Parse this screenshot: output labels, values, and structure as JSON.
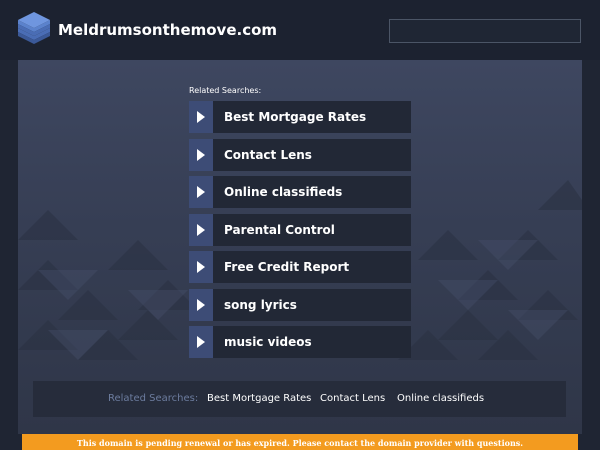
{
  "header": {
    "site_title": "Meldrumsonthemove.com",
    "logo_icon": "stacked-layers-icon",
    "search_placeholder": ""
  },
  "main": {
    "related_heading": "Related Searches:",
    "links": [
      {
        "label": "Best Mortgage Rates",
        "icon": "triangle-right-icon"
      },
      {
        "label": "Contact Lens",
        "icon": "triangle-right-icon"
      },
      {
        "label": "Online classifieds",
        "icon": "triangle-right-icon"
      },
      {
        "label": "Parental Control",
        "icon": "triangle-right-icon"
      },
      {
        "label": "Free Credit Report",
        "icon": "triangle-right-icon"
      },
      {
        "label": "song lyrics",
        "icon": "triangle-right-icon"
      },
      {
        "label": "music videos",
        "icon": "triangle-right-icon"
      }
    ]
  },
  "bottom_bar": {
    "label": "Related Searches:",
    "links": [
      "Best Mortgage Rates",
      "Contact Lens",
      "Online classifieds"
    ]
  },
  "notice": {
    "text": "This domain is pending renewal or has expired. Please contact the domain provider with questions."
  },
  "colors": {
    "header_bg": "#1c2230",
    "panel_bg": "#3e4760",
    "link_bg": "#222836",
    "arrow_bg": "#3d4c76",
    "notice_bg": "#f39b1f",
    "muted_text": "#6c7c9e"
  }
}
